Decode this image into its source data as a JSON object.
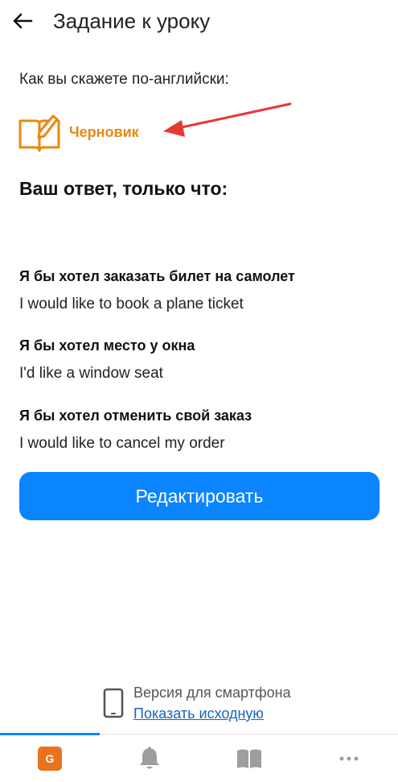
{
  "header": {
    "title": "Задание к уроку"
  },
  "prompt": "Как вы скажете по-английски:",
  "draft": {
    "label": "Черновик",
    "accent_color": "#E8880F"
  },
  "answer_heading": "Ваш ответ, только что:",
  "answers": [
    {
      "question": "Я бы хотел заказать билет на самолет",
      "answer": "I would like to book a plane ticket"
    },
    {
      "question": "Я бы хотел место у окна",
      "answer": "I'd like a window seat"
    },
    {
      "question": "Я бы хотел отменить свой заказ",
      "answer": "I would like to cancel my order"
    }
  ],
  "edit_button": {
    "label": "Редактировать",
    "color": "#0A84FF"
  },
  "version": {
    "text": "Версия для смартфона",
    "link": "Показать исходную"
  },
  "bottom_nav": {
    "items": [
      {
        "icon": "g-badge-icon",
        "label": "G",
        "active": true
      },
      {
        "icon": "bell-icon"
      },
      {
        "icon": "book-icon"
      },
      {
        "icon": "more-icon"
      }
    ]
  },
  "colors": {
    "primary": "#0A84FF",
    "accent": "#E8731C",
    "annotation_arrow": "#E53935"
  }
}
